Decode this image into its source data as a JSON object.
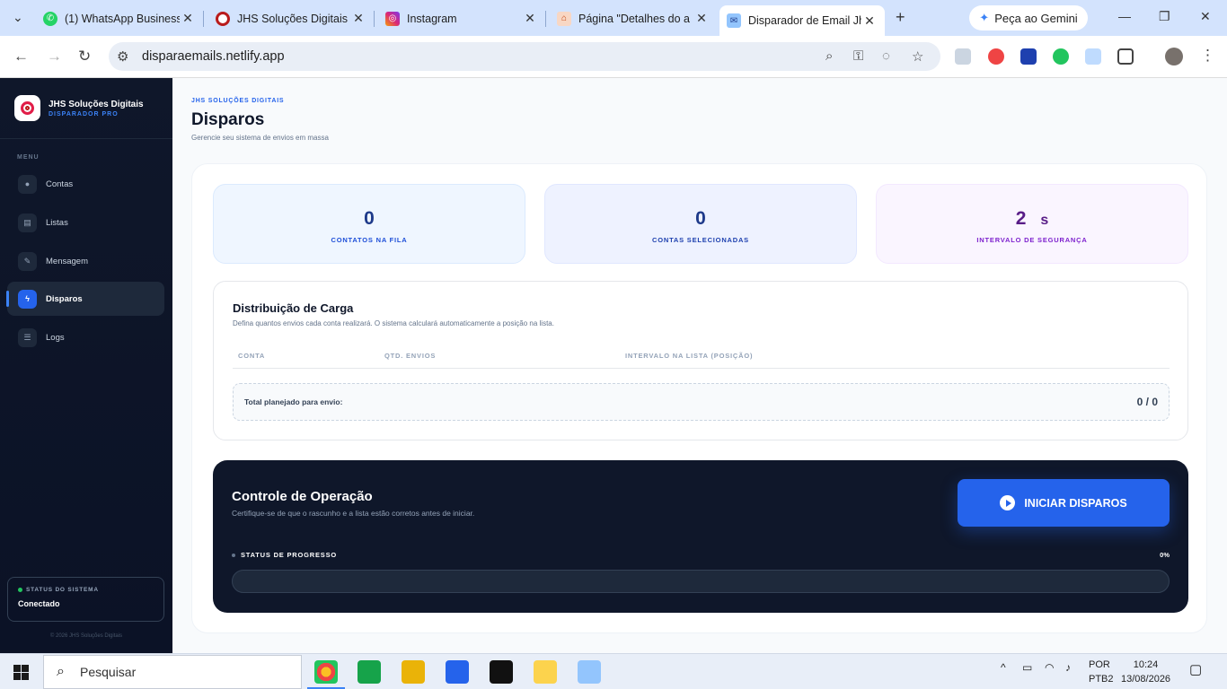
{
  "browser": {
    "tabs": [
      {
        "title": "(1) WhatsApp Business",
        "icon": "whatsapp-icon"
      },
      {
        "title": "JHS Soluções Digitais |",
        "icon": "jhs-icon"
      },
      {
        "title": "Instagram",
        "icon": "instagram-icon"
      },
      {
        "title": "Página \"Detalhes do a",
        "icon": "page-icon"
      },
      {
        "title": "Disparador de Email Jh",
        "icon": "mail-icon"
      }
    ],
    "gemini_label": "Peça ao Gemini",
    "url": "disparaemails.netlify.app"
  },
  "sidebar": {
    "brand_name": "JHS Soluções Digitais",
    "brand_sub": "DISPARADOR PRO",
    "menu_label": "MENU",
    "items": [
      {
        "label": "Contas",
        "icon": "users-icon"
      },
      {
        "label": "Listas",
        "icon": "list-icon"
      },
      {
        "label": "Mensagem",
        "icon": "edit-icon"
      },
      {
        "label": "Disparos",
        "icon": "bolt-icon"
      },
      {
        "label": "Logs",
        "icon": "logs-icon"
      }
    ],
    "active_item": "Disparos",
    "status_label": "STATUS DO SISTEMA",
    "status_value": "Conectado",
    "copyright": "© 2026 JHS Soluções Digitais"
  },
  "page": {
    "breadcrumb": "JHS SOLUÇÕES DIGITAIS",
    "title": "Disparos",
    "subtitle": "Gerencie seu sistema de envios em massa"
  },
  "stats": {
    "queue_value": "0",
    "queue_label": "CONTATOS NA FILA",
    "accounts_value": "0",
    "accounts_label": "CONTAS SELECIONADAS",
    "interval_value": "2",
    "interval_unit": "s",
    "interval_label": "INTERVALO DE SEGURANÇA"
  },
  "distribution": {
    "title": "Distribuição de Carga",
    "description": "Defina quantos envios cada conta realizará. O sistema calculará automaticamente a posição na lista.",
    "columns": [
      "CONTA",
      "QTD. ENVIOS",
      "INTERVALO NA LISTA (POSIÇÃO)"
    ],
    "rows": [],
    "total_label": "Total planejado para envio:",
    "total_value": "0 / 0"
  },
  "control": {
    "title": "Controle de Operação",
    "description": "Certifique-se de que o rascunho e a lista estão corretos antes de iniciar.",
    "start_button": "INICIAR DISPAROS",
    "progress_label": "STATUS DE PROGRESSO",
    "progress_text": "0%",
    "progress_value": 0
  },
  "taskbar": {
    "search_placeholder": "Pesquisar",
    "lang_1": "POR",
    "lang_2": "PTB2",
    "time": "10:24",
    "date": "13/08/2026"
  },
  "colors": {
    "accent": "#2563eb",
    "sidebar_bg": "#0f172a",
    "interval_text": "#581c87"
  }
}
